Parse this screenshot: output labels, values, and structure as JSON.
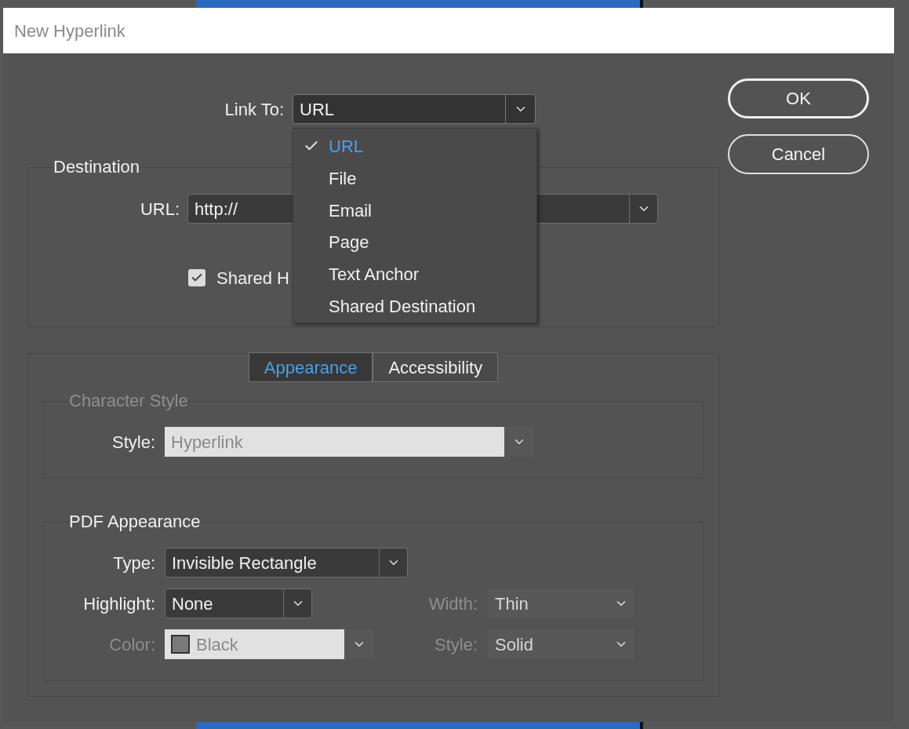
{
  "window": {
    "title": "New Hyperlink"
  },
  "link_to": {
    "label": "Link To:",
    "value": "URL",
    "menu": [
      {
        "label": "URL",
        "selected": true
      },
      {
        "label": "File",
        "selected": false
      },
      {
        "label": "Email",
        "selected": false
      },
      {
        "label": "Page",
        "selected": false
      },
      {
        "label": "Text Anchor",
        "selected": false
      },
      {
        "label": "Shared Destination",
        "selected": false
      }
    ]
  },
  "destination": {
    "title": "Destination",
    "url": {
      "label": "URL:",
      "value": "http://"
    },
    "shared": {
      "label": "Shared H",
      "checked": true
    }
  },
  "tabs": [
    {
      "label": "Appearance",
      "selected": true
    },
    {
      "label": "Accessibility",
      "selected": false
    }
  ],
  "character_style": {
    "title": "Character Style",
    "disabled": true,
    "style": {
      "kind": "combo",
      "label": "Style:",
      "value": "Hyperlink",
      "disabled": true
    }
  },
  "pdf_appearance": {
    "title": "PDF Appearance",
    "disabled": false,
    "rows": [
      {
        "fields": [
          {
            "kind": "select",
            "label": "Type:",
            "value": "Invisible Rectangle",
            "disabled": false
          }
        ]
      },
      {
        "fields": [
          {
            "kind": "select",
            "label": "Highlight:",
            "value": "None",
            "disabled": false
          },
          {
            "kind": "select",
            "label": "Width:",
            "value": "Thin",
            "disabled": true
          }
        ]
      },
      {
        "fields": [
          {
            "kind": "swatch",
            "label": "Color:",
            "value": "Black",
            "disabled": true
          },
          {
            "kind": "select",
            "label": "Style:",
            "value": "Solid",
            "disabled": true
          }
        ]
      }
    ]
  },
  "buttons": [
    {
      "label": "OK",
      "default": true
    },
    {
      "label": "Cancel",
      "default": false
    }
  ]
}
